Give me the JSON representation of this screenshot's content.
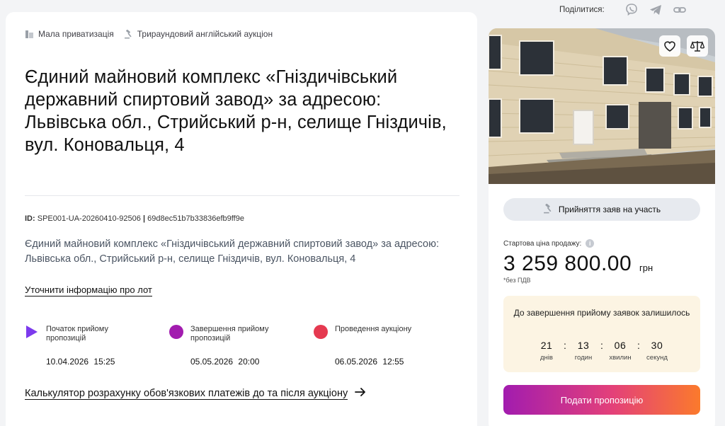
{
  "tags": {
    "privatization": "Мала приватизація",
    "auction_type": "Трираундовий англійський аукціон"
  },
  "lot": {
    "title": "Єдиний майновий комплекс «Гніздичівський державний спиртовий завод» за адресою: Львівська обл., Стрийський р-н, селище Гніздичів, вул. Коновальця, 4",
    "id_label": "ID:",
    "id_value": "SPE001-UA-20260410-92506",
    "id_sep": "|",
    "hash": "69d8ec51b7b33836efb9ff9e",
    "description": "Єдиний майновий комплекс «Гніздичівський державний спиртовий завод» за адресою: Львівська обл., Стрийський р-н, селище Гніздичів, вул. Коновальця, 4",
    "info_link": "Уточнити інформацію про лот",
    "calc_link": "Калькулятор розрахунку обов'язкових платежів до та після аукціону"
  },
  "timeline": [
    {
      "label": "Початок прийому пропозицій",
      "date": "10.04.2026  15:25",
      "color": "#7c3aed"
    },
    {
      "label": "Завершення прийому пропозицій",
      "date": "05.05.2026  20:00",
      "color": "#a21caf"
    },
    {
      "label": "Проведення аукціону",
      "date": "06.05.2026  12:55",
      "color": "#e53950"
    }
  ],
  "share": {
    "label": "Поділитися:",
    "icons": [
      "viber-icon",
      "telegram-icon",
      "link-icon"
    ]
  },
  "sidebar": {
    "status": "Прийняття заяв на участь",
    "price_label": "Стартова ціна продажу:",
    "price": "3 259 800.00",
    "currency": "грн",
    "vat": "*без ПДВ",
    "timer_title": "До завершення прийому заявок залишилось",
    "timer": {
      "days": "21",
      "days_label": "днів",
      "hours": "13",
      "hours_label": "годин",
      "minutes": "06",
      "minutes_label": "хвилин",
      "seconds": "30",
      "seconds_label": "секунд"
    },
    "submit": "Подати пропозицію"
  },
  "colors": {
    "accent_gradient_start": "#a21caf",
    "accent_gradient_end": "#fb7a2c",
    "timer_bg": "#fcf4e3"
  }
}
